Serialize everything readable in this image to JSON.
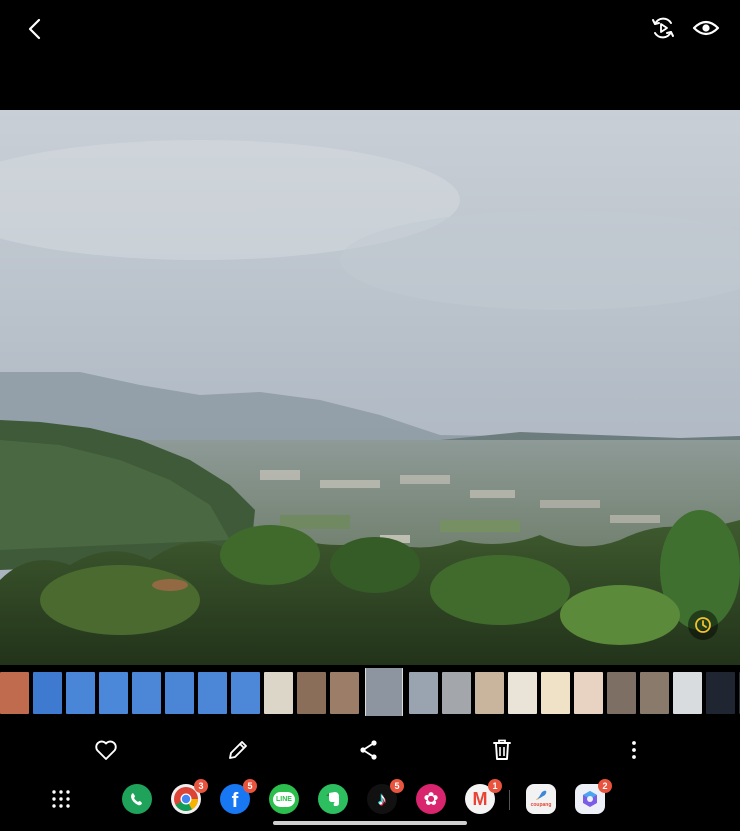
{
  "viewer": {
    "top_icons": [
      "back-arrow-icon",
      "motion-photo-icon",
      "eye-icon"
    ]
  },
  "filmstrip": {
    "thumbs": [
      {
        "name": "thumb-1",
        "color": "#c06a4e"
      },
      {
        "name": "thumb-2",
        "color": "#3d7ad0"
      },
      {
        "name": "thumb-3",
        "color": "#4a86d8"
      },
      {
        "name": "thumb-4",
        "color": "#4c88da"
      },
      {
        "name": "thumb-5",
        "color": "#4b87d6"
      },
      {
        "name": "thumb-6",
        "color": "#4a85d6"
      },
      {
        "name": "thumb-7",
        "color": "#4b86d7"
      },
      {
        "name": "thumb-8",
        "color": "#4d88d8"
      },
      {
        "name": "thumb-9",
        "color": "#dcd6c8"
      },
      {
        "name": "thumb-10",
        "color": "#8a6e5a"
      },
      {
        "name": "thumb-11",
        "color": "#9b7d68"
      },
      {
        "name": "thumb-current",
        "color": "#8d96a0"
      },
      {
        "name": "thumb-13",
        "color": "#9aa4b0"
      },
      {
        "name": "thumb-14",
        "color": "#a3a6aa"
      },
      {
        "name": "thumb-15",
        "color": "#c9b49e"
      },
      {
        "name": "thumb-16",
        "color": "#e9e3d8"
      },
      {
        "name": "thumb-17",
        "color": "#f0e2c6"
      },
      {
        "name": "thumb-18",
        "color": "#e8d3c3"
      },
      {
        "name": "thumb-19",
        "color": "#7d6f64"
      },
      {
        "name": "thumb-20",
        "color": "#8a7a6c"
      },
      {
        "name": "thumb-21",
        "color": "#d9dcdf"
      },
      {
        "name": "thumb-22",
        "color": "#1f2631"
      },
      {
        "name": "thumb-23",
        "color": "#2a3340"
      }
    ]
  },
  "actions": [
    "heart-icon",
    "edit-pencil-icon",
    "share-icon",
    "trash-icon",
    "more-vertical-icon"
  ],
  "dock": {
    "apps": [
      {
        "name": "phone",
        "color": "#1fa35a",
        "glyph": "☎",
        "badge": ""
      },
      {
        "name": "chrome",
        "color": "#f0f0f0",
        "glyph": "",
        "badge": "3"
      },
      {
        "name": "facebook",
        "color": "#1877f2",
        "glyph": "f",
        "badge": "5"
      },
      {
        "name": "line",
        "color": "#2cbf4e",
        "glyph": "LINE",
        "badge": ""
      },
      {
        "name": "evernote",
        "color": "#2dbe60",
        "glyph": "",
        "badge": ""
      },
      {
        "name": "tiktok",
        "color": "#111111",
        "glyph": "♪",
        "badge": "5"
      },
      {
        "name": "flower-app",
        "color": "#d9256e",
        "glyph": "✿",
        "badge": ""
      },
      {
        "name": "gmail",
        "color": "#f4f4f4",
        "glyph": "M",
        "badge": "1"
      },
      {
        "name": "coupang",
        "color": "#f2f2f2",
        "glyph": "",
        "badge": ""
      },
      {
        "name": "copilot",
        "color": "#eef0f7",
        "glyph": "",
        "badge": "2"
      }
    ],
    "line_label": "LINE",
    "coupang_label": "coupang"
  }
}
